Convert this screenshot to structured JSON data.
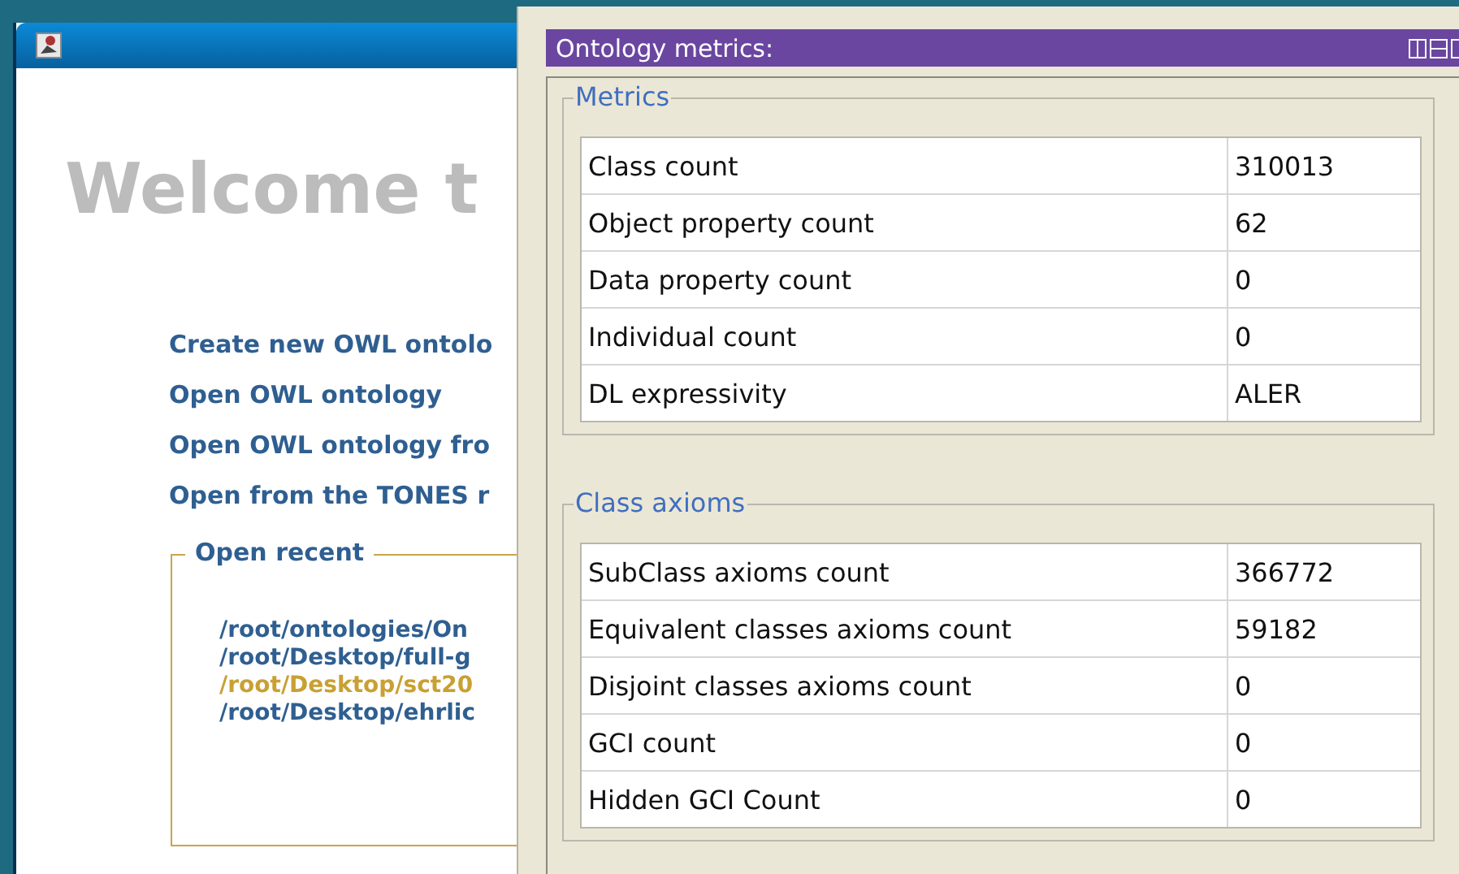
{
  "welcome_window": {
    "heading": "Welcome t",
    "actions": [
      "Create new OWL ontolo",
      "Open OWL ontology",
      "Open OWL ontology fro",
      "Open from the TONES r"
    ],
    "open_recent": {
      "title": "Open recent",
      "files": [
        {
          "path": "/root/ontologies/On",
          "highlighted": false
        },
        {
          "path": "/root/Desktop/full-g",
          "highlighted": false
        },
        {
          "path": "/root/Desktop/sct20",
          "highlighted": true
        },
        {
          "path": "/root/Desktop/ehrlic",
          "highlighted": false
        }
      ]
    }
  },
  "metrics_panel": {
    "title": "Ontology metrics:",
    "groups": [
      {
        "title": "Metrics",
        "rows": [
          {
            "label": "Class count",
            "value": "310013"
          },
          {
            "label": "Object property count",
            "value": "62"
          },
          {
            "label": "Data property count",
            "value": "0"
          },
          {
            "label": "Individual count",
            "value": "0"
          },
          {
            "label": "DL expressivity",
            "value": "ALER"
          }
        ]
      },
      {
        "title": "Class axioms",
        "rows": [
          {
            "label": "SubClass axioms count",
            "value": "366772"
          },
          {
            "label": "Equivalent classes axioms count",
            "value": "59182"
          },
          {
            "label": "Disjoint classes axioms count",
            "value": "0"
          },
          {
            "label": "GCI count",
            "value": "0"
          },
          {
            "label": "Hidden GCI Count",
            "value": "0"
          }
        ]
      }
    ]
  }
}
